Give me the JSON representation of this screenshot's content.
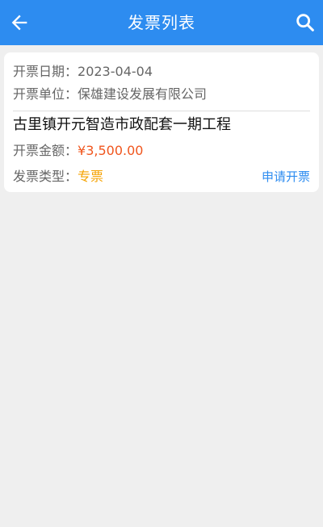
{
  "header": {
    "title": "发票列表",
    "back_icon": "arrow-left-icon",
    "search_icon": "search-icon",
    "color": "#2d8cf0"
  },
  "invoices": [
    {
      "date_label": "开票日期：",
      "date": "2023-04-04",
      "unit_label": "开票单位：",
      "unit": "保雄建设发展有限公司",
      "project": "古里镇开元智造市政配套一期工程",
      "amount_label": "开票金额：",
      "amount": "¥3,500.00",
      "type_label": "发票类型：",
      "type": "专票",
      "action_label": "申请开票"
    }
  ],
  "colors": {
    "amount": "#f0561e",
    "type": "#f5a200",
    "link": "#2d8cf0"
  }
}
